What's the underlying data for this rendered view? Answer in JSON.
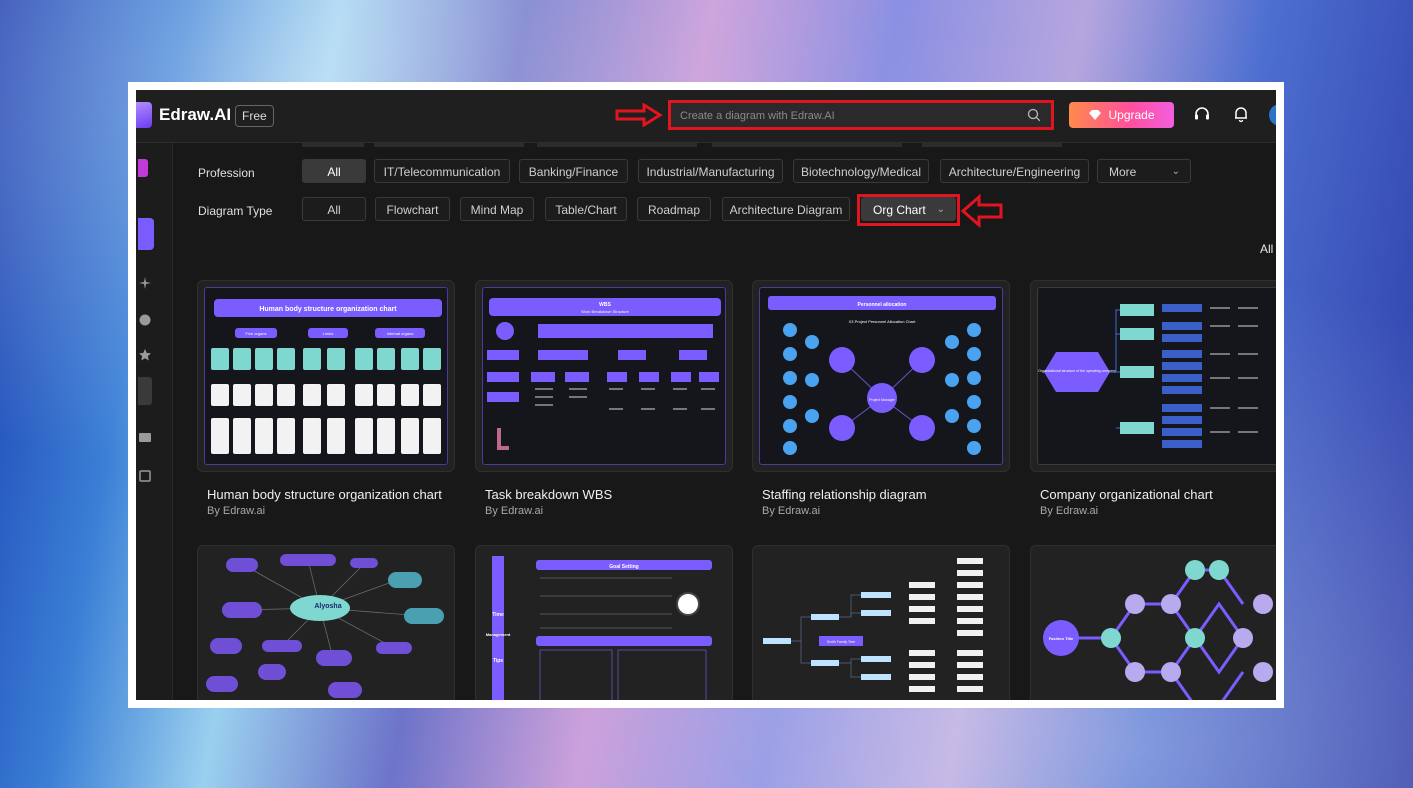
{
  "header": {
    "brand": "Edraw.AI",
    "badge": "Free",
    "search_placeholder": "Create a diagram with Edraw.AI",
    "upgrade_label": "Upgrade"
  },
  "filters": {
    "profession_label": "Profession",
    "profession_options": [
      "All",
      "IT/Telecommunication",
      "Banking/Finance",
      "Industrial/Manufacturing",
      "Biotechnology/Medical",
      "Architecture/Engineering"
    ],
    "more_label": "More",
    "diagram_type_label": "Diagram Type",
    "diagram_type_options": [
      "All",
      "Flowchart",
      "Mind Map",
      "Table/Chart",
      "Roadmap",
      "Architecture Diagram"
    ],
    "selected_type": "Org Chart",
    "all_link": "All"
  },
  "templates": [
    {
      "title": "Human body structure organization chart",
      "author": "By Edraw.ai"
    },
    {
      "title": "Task breakdown WBS",
      "author": "By Edraw.ai"
    },
    {
      "title": "Staffing relationship diagram",
      "author": "By Edraw.ai"
    },
    {
      "title": "Company organizational chart",
      "author": "By Edraw.ai"
    }
  ],
  "thumbnails": {
    "t1_title": "Human body structure organization chart",
    "t1_groups": [
      "Five organs",
      "Limbs",
      "Internal organs"
    ],
    "t2_title": "WBS",
    "t2_subtitle": "Work Breakdown Structure",
    "t3_title": "Personnel allocation",
    "t3_subtitle": "X3 Project Personnel Allocation Chart",
    "t3_center": "Project Manager",
    "t4_root": "Organizational structure of the operating company",
    "r2_t1_center": "Alyosha",
    "r2_t2_title": "Goal Setting",
    "r2_t2_side": [
      "Time",
      "Management",
      "Tips"
    ],
    "r2_t3_center": "Smith Family Tree",
    "r2_t4_center": "Fashion Title"
  },
  "colors": {
    "accent": "#7b5cff",
    "highlight": "#e1141f",
    "upgrade_start": "#ff8a4b",
    "upgrade_end": "#f35fdf",
    "teal": "#7fd8cf"
  }
}
